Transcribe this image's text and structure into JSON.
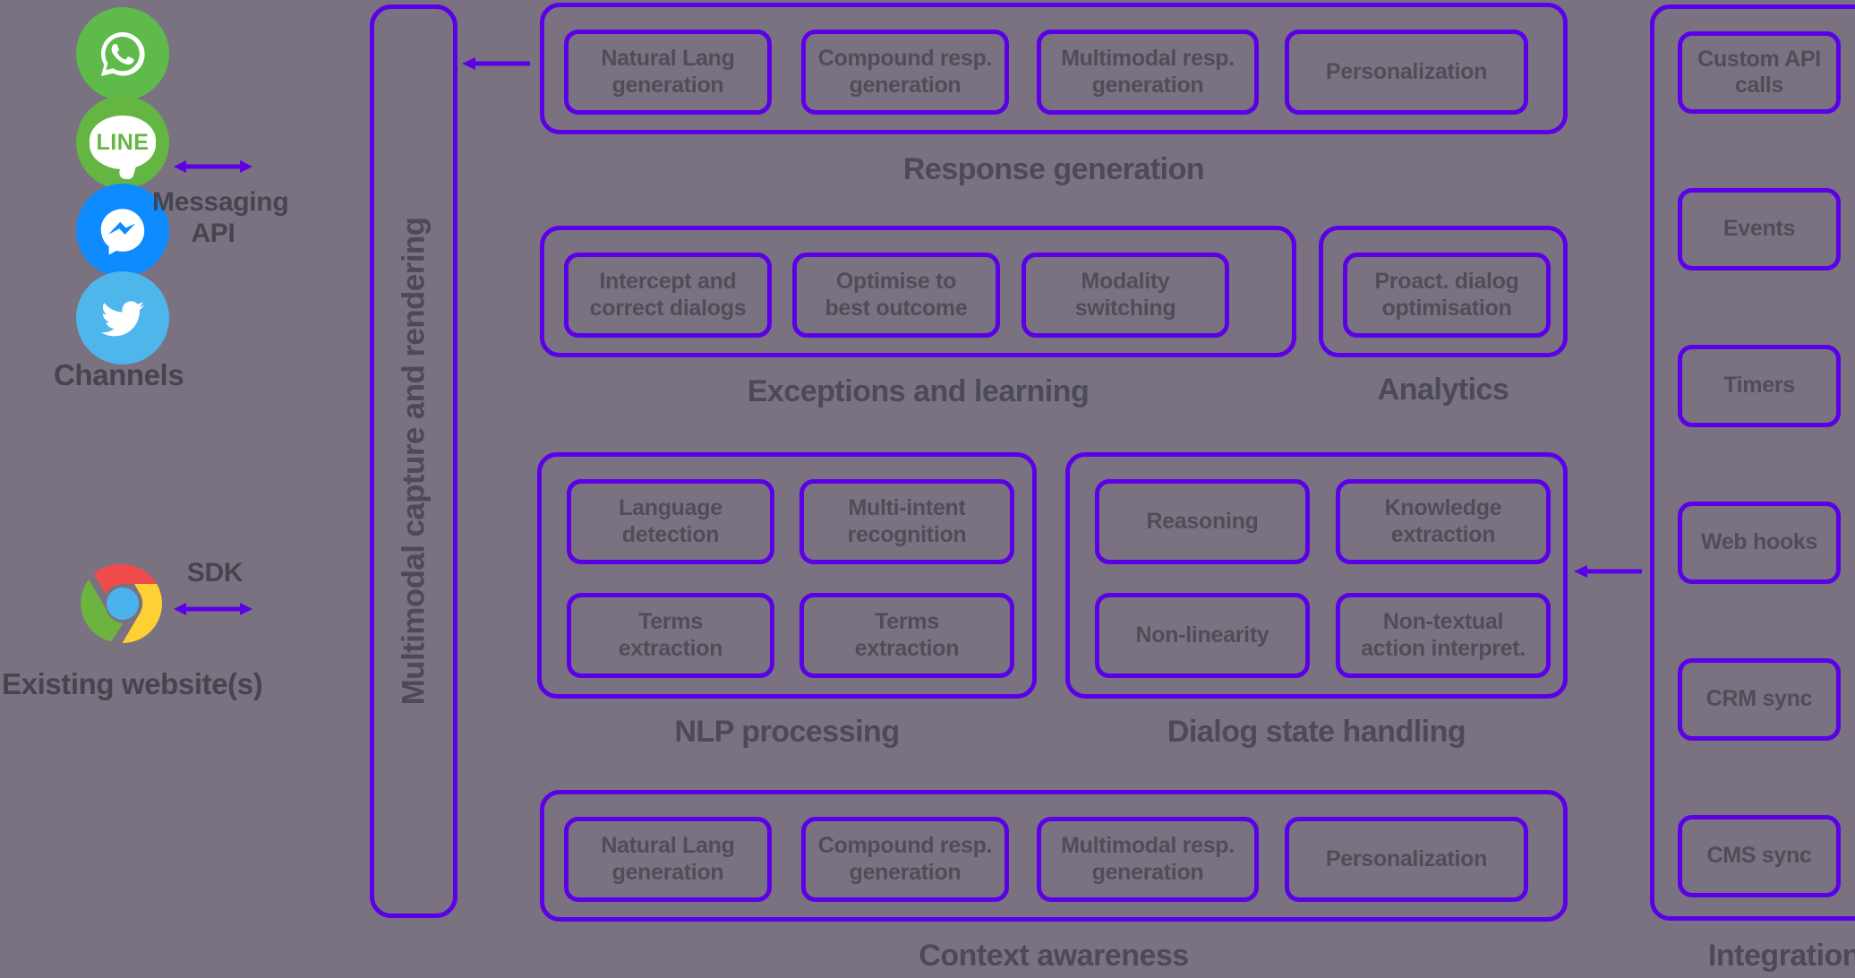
{
  "colors": {
    "background": "#7a7280",
    "accent_purple": "#5c00e8",
    "label_text": "#4b4a56",
    "card_text": "#4e4d58"
  },
  "left_column": {
    "channels_caption": "Channels",
    "website_caption": "Existing website(s)",
    "channel_icons": [
      {
        "name": "whatsapp-icon",
        "label": "WhatsApp",
        "color": "#5ebb4b"
      },
      {
        "name": "line-icon",
        "label": "LINE",
        "color": "#63b641"
      },
      {
        "name": "messenger-icon",
        "label": "Messenger",
        "color": "#0d8bff"
      },
      {
        "name": "twitter-icon",
        "label": "Twitter",
        "color": "#4fb6ec"
      }
    ],
    "browser_icon": {
      "name": "chrome-icon",
      "label": "Chrome"
    },
    "connectors": [
      {
        "label": "Messaging\nAPI",
        "line1": "Messaging",
        "line2": "API",
        "direction": "bidirectional"
      },
      {
        "label": "SDK",
        "line1": "SDK",
        "line2": "",
        "direction": "bidirectional"
      }
    ]
  },
  "vertical_bar": {
    "label": "Multimodal capture and rendering"
  },
  "groups": [
    {
      "id": "response-generation",
      "label": "Response generation",
      "cards": [
        {
          "line1": "Natural Lang",
          "line2": "generation"
        },
        {
          "line1": "Compound resp.",
          "line2": "generation"
        },
        {
          "line1": "Multimodal resp.",
          "line2": "generation"
        },
        {
          "line1": "Personalization",
          "line2": ""
        }
      ]
    },
    {
      "id": "exceptions-and-learning",
      "label": "Exceptions and learning",
      "cards": [
        {
          "line1": "Intercept and",
          "line2": "correct dialogs"
        },
        {
          "line1": "Optimise to",
          "line2": "best outcome"
        },
        {
          "line1": "Modality",
          "line2": "switching"
        }
      ]
    },
    {
      "id": "analytics",
      "label": "Analytics",
      "cards": [
        {
          "line1": "Proact. dialog",
          "line2": "optimisation"
        }
      ]
    },
    {
      "id": "nlp-processing",
      "label": "NLP processing",
      "cards": [
        {
          "line1": "Language",
          "line2": "detection"
        },
        {
          "line1": "Multi-intent",
          "line2": "recognition"
        },
        {
          "line1": "Terms",
          "line2": "extraction"
        },
        {
          "line1": "Terms",
          "line2": "extraction"
        }
      ]
    },
    {
      "id": "dialog-state-handling",
      "label": "Dialog state handling",
      "cards": [
        {
          "line1": "Reasoning",
          "line2": ""
        },
        {
          "line1": "Knowledge",
          "line2": "extraction"
        },
        {
          "line1": "Non-linearity",
          "line2": ""
        },
        {
          "line1": "Non-textual",
          "line2": "action interpret."
        }
      ]
    },
    {
      "id": "context-awareness",
      "label": "Context awareness",
      "cards": [
        {
          "line1": "Natural Lang",
          "line2": "generation"
        },
        {
          "line1": "Compound resp.",
          "line2": "generation"
        },
        {
          "line1": "Multimodal resp.",
          "line2": "generation"
        },
        {
          "line1": "Personalization",
          "line2": ""
        }
      ]
    }
  ],
  "integration": {
    "label": "Integration",
    "items": [
      {
        "line1": "Custom API",
        "line2": "calls"
      },
      {
        "line1": "Events",
        "line2": ""
      },
      {
        "line1": "Timers",
        "line2": ""
      },
      {
        "line1": "Web hooks",
        "line2": ""
      },
      {
        "line1": "CRM sync",
        "line2": ""
      },
      {
        "line1": "CMS sync",
        "line2": ""
      }
    ]
  }
}
